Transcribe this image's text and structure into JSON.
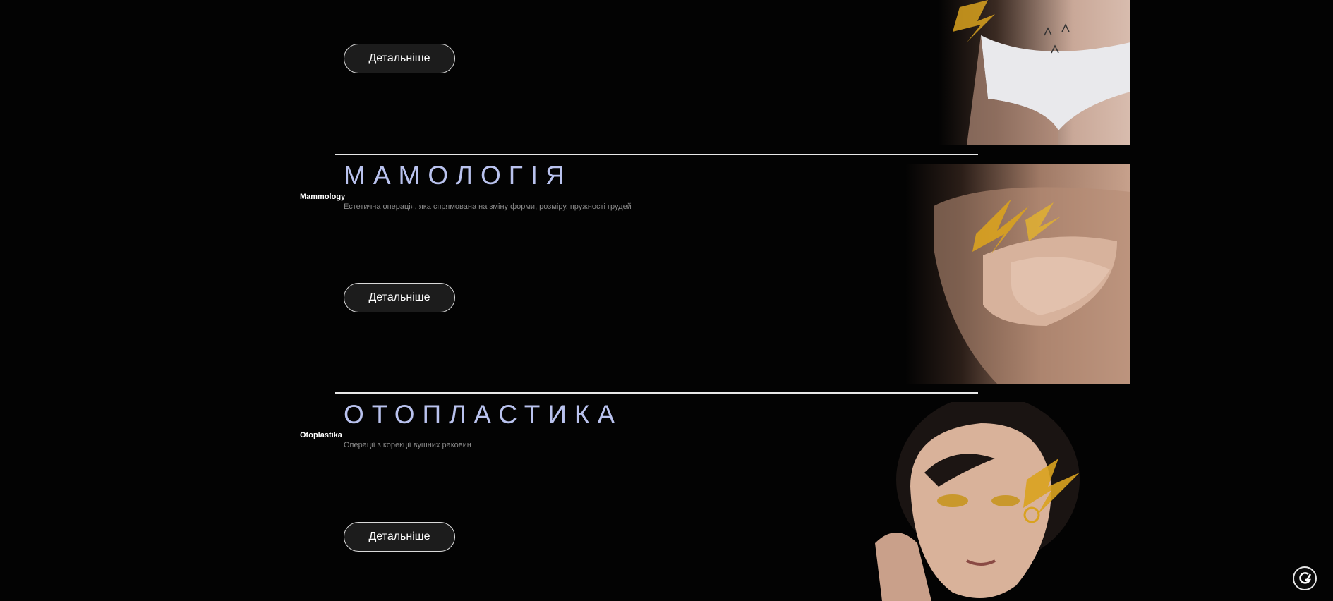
{
  "sections": [
    {
      "button_label": "Детальніше"
    },
    {
      "side_label": "Mammology",
      "title": "МАМОЛОГІЯ",
      "description": "Естетична операція, яка спрямована на зміну форми, розміру, пружності грудей",
      "button_label": "Детальніше"
    },
    {
      "side_label": "Otoplastika",
      "title": "ОТОПЛАСТИКА",
      "description": "Операції з корекції вушних раковин",
      "button_label": "Детальніше"
    }
  ],
  "colors": {
    "background": "#030303",
    "title": "#b9c2ee",
    "description": "#8a8a8a",
    "gold_accent": "#d9a21f"
  },
  "icons": {
    "fab": "chat-widget-icon"
  }
}
